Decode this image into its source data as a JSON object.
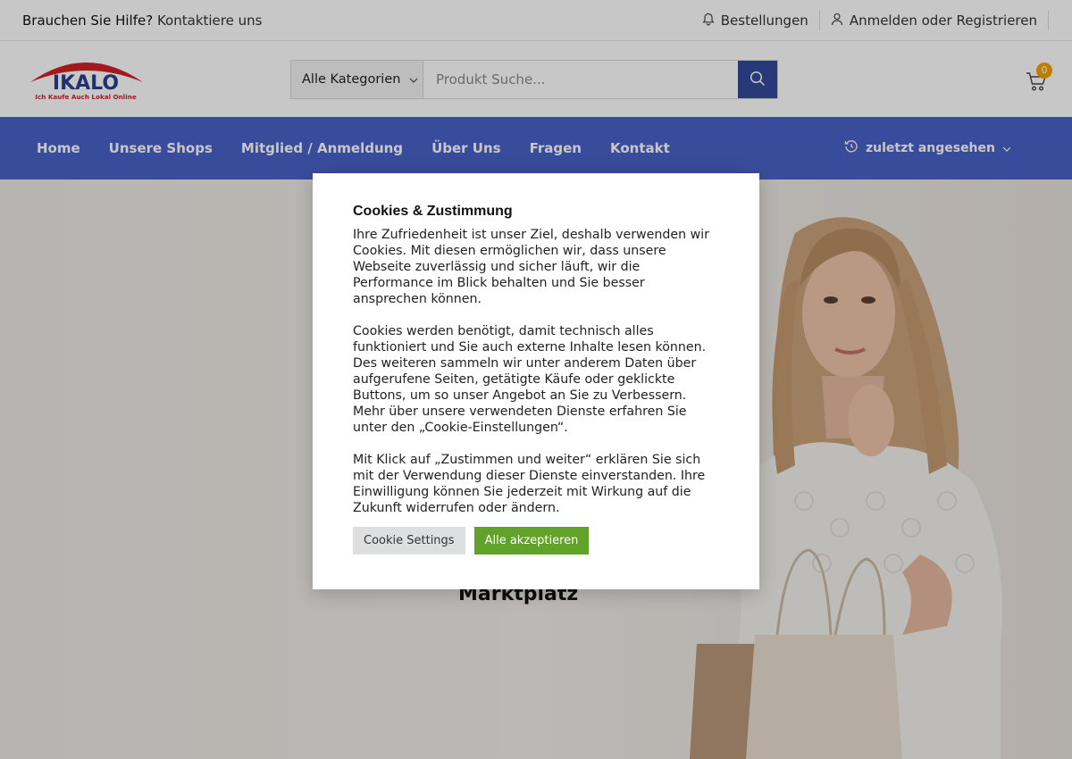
{
  "topbar": {
    "help_text": "Brauchen Sie Hilfe?",
    "contact_link": "Kontaktiere uns",
    "orders_label": "Bestellungen",
    "login_label": "Anmelden oder Registrieren"
  },
  "header": {
    "logo_name": "IKALO",
    "logo_tagline": "Ich Kaufe Auch Lokal Online",
    "category_select": "Alle Kategorien",
    "search_placeholder": "Produkt Suche...",
    "cart_count": "0"
  },
  "nav": {
    "items": [
      "Home",
      "Unsere Shops",
      "Mitglied / Anmeldung",
      "Über Uns",
      "Fragen",
      "Kontakt"
    ],
    "recent_label": "zuletzt angesehen"
  },
  "hero": {
    "text": "Marktplatz"
  },
  "cookie": {
    "title": "Cookies & Zustimmung",
    "paragraphs": [
      "Ihre Zufriedenheit ist unser Ziel, deshalb verwenden wir Cookies. Mit diesen ermöglichen wir, dass unsere Webseite zuverlässig und sicher läuft, wir die Performance im Blick behalten und Sie besser ansprechen können.",
      "Cookies werden benötigt, damit technisch alles funktioniert und Sie auch externe Inhalte lesen können. Des weiteren sammeln wir unter anderem Daten über aufgerufene Seiten, getätigte Käufe oder geklickte Buttons, um so unser Angebot an Sie zu Verbessern. Mehr über unsere verwendeten Dienste erfahren Sie unter den „Cookie-Einstellungen“.",
      "Mit Klick auf „Zustimmen und weiter“ erklären Sie sich mit der Verwendung dieser Dienste einverstanden. Ihre Einwilligung können Sie jederzeit mit Wirkung auf die Zukunft widerrufen oder ändern."
    ],
    "settings_button": "Cookie Settings",
    "accept_button": "Alle akzeptieren"
  },
  "colors": {
    "nav_bg": "#4a62c8",
    "search_button": "#34499c",
    "accept_button": "#61a229",
    "cart_badge": "#f0a500",
    "logo_red": "#d32027",
    "logo_blue": "#2a3f8f"
  },
  "icons": [
    "bell-icon",
    "user-icon",
    "chevron-down-icon",
    "search-icon",
    "cart-icon",
    "history-icon"
  ]
}
